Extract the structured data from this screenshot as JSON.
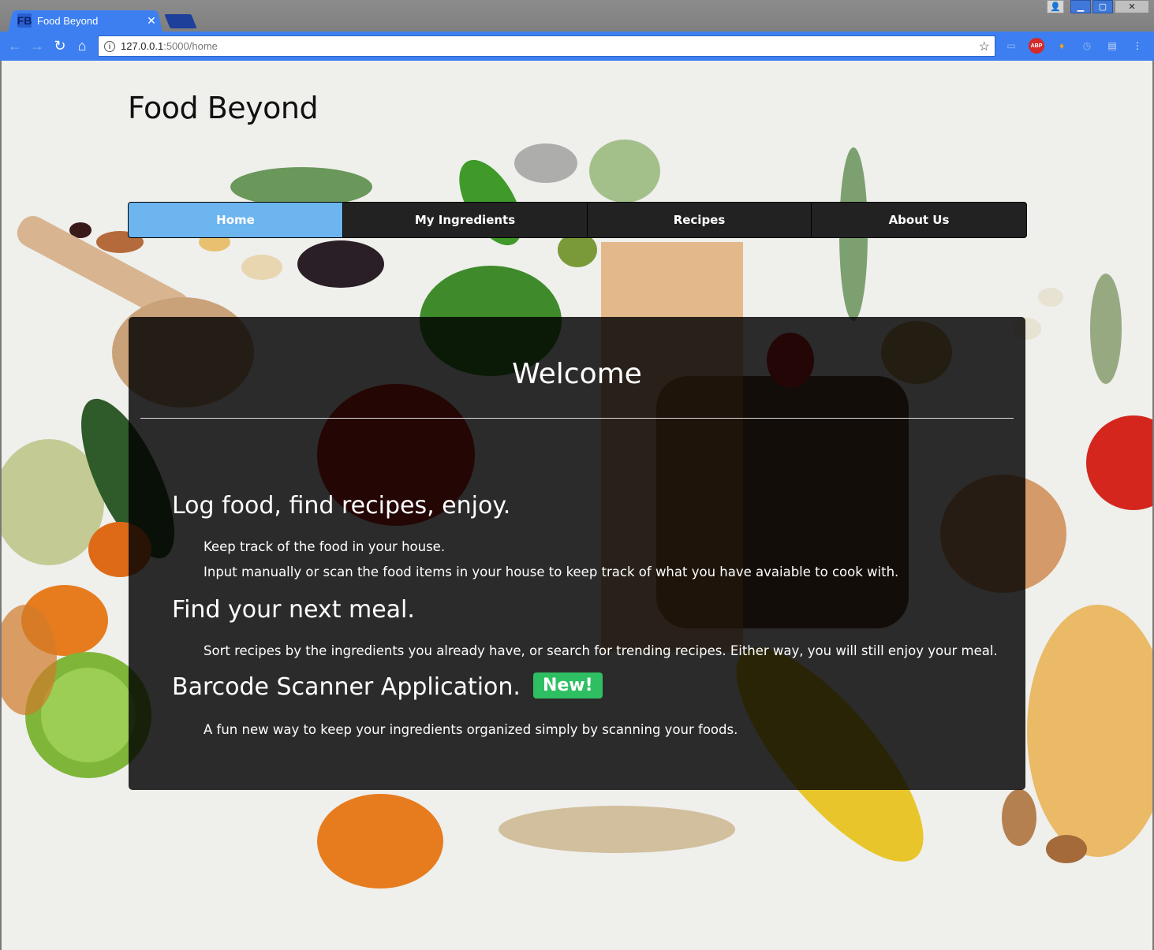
{
  "browser": {
    "tab_title": "Food Beyond",
    "tab_favicon_text": "FB",
    "url_host": "127.0.0.1",
    "url_path": ":5000/home",
    "extension_abp_label": "ABP"
  },
  "site": {
    "title": "Food Beyond"
  },
  "nav": {
    "items": [
      {
        "label": "Home",
        "active": true
      },
      {
        "label": "My Ingredients",
        "active": false
      },
      {
        "label": "Recipes",
        "active": false
      },
      {
        "label": "About Us",
        "active": false
      }
    ]
  },
  "main": {
    "heading": "Welcome",
    "features": [
      {
        "title": "Log food, find recipes, enjoy.",
        "lines": [
          "Keep track of the food in your house.",
          "Input manually or scan the food items in your house to keep track of what you have avaiable to cook with."
        ]
      },
      {
        "title": "Find your next meal.",
        "lines": [
          "Sort recipes by the ingredients you already have, or search for trending recipes. Either way, you will still enjoy your meal."
        ]
      },
      {
        "title": "Barcode Scanner Application.",
        "badge": "New!",
        "lines": [
          "A fun new way to keep your ingredients organized simply by scanning your foods."
        ]
      }
    ]
  },
  "colors": {
    "browser_accent": "#3d7ff0",
    "nav_active": "#6cb5ef",
    "nav_bg": "#222222",
    "badge": "#2fbf63"
  }
}
